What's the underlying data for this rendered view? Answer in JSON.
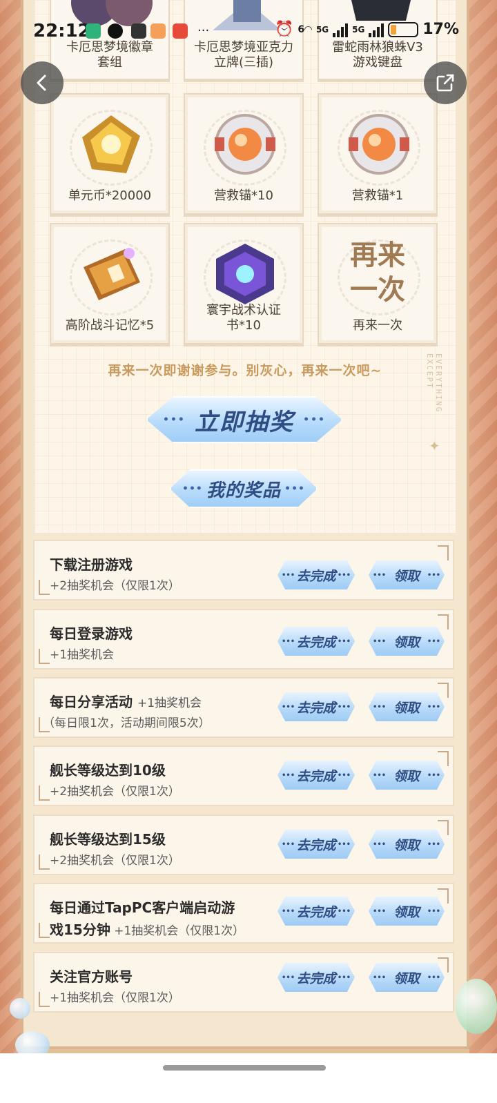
{
  "status_bar": {
    "time": "22:12",
    "network_left": "5G",
    "network_right": "5G",
    "battery": "17%",
    "wifi_label": "6"
  },
  "nav": {
    "back_icon": "chevron-left-icon",
    "share_icon": "share-out-icon"
  },
  "prizes_top": [
    {
      "label": "卡厄思梦境徽章\n套组"
    },
    {
      "label": "卡厄思梦境亚克力\n立牌(三插)"
    },
    {
      "label": "雷蛇雨林狼蛛V3\n游戏键盘"
    }
  ],
  "prizes": [
    {
      "label": "单元币*20000",
      "icon": "coin-icon"
    },
    {
      "label": "营救锚*10",
      "icon": "anchor-icon"
    },
    {
      "label": "营救锚*1",
      "icon": "anchor-icon"
    },
    {
      "label": "高阶战斗记忆*5",
      "icon": "ticket-icon"
    },
    {
      "label": "寰宇战术认证\n书*10",
      "icon": "box-icon"
    },
    {
      "label": "再来一次",
      "big": "再来\n一次",
      "icon": "retry-text"
    }
  ],
  "hint": "再来一次即谢谢参与。别灰心，再来一次吧~",
  "side_deco": "EVERYTHING EXCEPT",
  "draw_button": "立即抽奖",
  "my_prizes_button": "我的奖品",
  "tasks": [
    {
      "title": "下载注册游戏",
      "title_suffix": "",
      "sub": "+2抽奖机会（仅限1次）"
    },
    {
      "title": "每日登录游戏",
      "title_suffix": "",
      "sub": "+1抽奖机会"
    },
    {
      "title": "每日分享活动",
      "title_suffix": "+1抽奖机会",
      "sub": "（每日限1次，活动期间限5次）"
    },
    {
      "title": "舰长等级达到10级",
      "title_suffix": "",
      "sub": "+2抽奖机会（仅限1次）"
    },
    {
      "title": "舰长等级达到15级",
      "title_suffix": "",
      "sub": "+2抽奖机会（仅限1次）"
    },
    {
      "title": "每日通过TapPC客户端启动游",
      "title_suffix": "",
      "sub_bold": "戏15分钟",
      "sub": "+1抽奖机会（仅限1次）"
    },
    {
      "title": "关注官方账号",
      "title_suffix": "",
      "sub": "+1抽奖机会（仅限1次）"
    }
  ],
  "task_buttons": {
    "go": "去完成",
    "claim": "领取"
  }
}
